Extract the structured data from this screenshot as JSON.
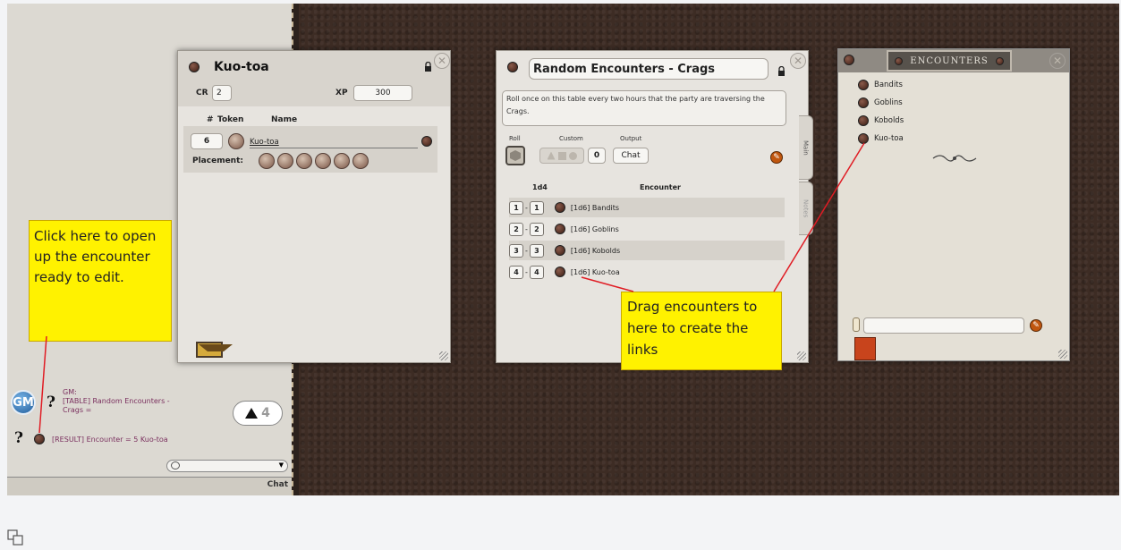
{
  "chat": {
    "gm_label": "GM",
    "line1_sender": "GM:",
    "line1_text": "[TABLE] Random Encounters -",
    "line1_text2": "Crags =",
    "line2_text": "[RESULT] Encounter = 5 Kuo-toa",
    "die_value": "4",
    "send_label": "Chat"
  },
  "npc_window": {
    "title": "Kuo-toa",
    "cr_label": "CR",
    "cr_value": "2",
    "xp_label": "XP",
    "xp_value": "300",
    "col_num": "#",
    "col_token": "Token",
    "col_name": "Name",
    "row_count": "6",
    "row_name": "Kuo-toa",
    "placement_label": "Placement:"
  },
  "table_window": {
    "title": "Random Encounters - Crags",
    "description": "Roll once on this table every two hours that the party are traversing the Crags.",
    "roll_label": "Roll",
    "custom_label": "Custom",
    "output_label": "Output",
    "custom_value": "0",
    "output_value": "Chat",
    "tab_main": "Main",
    "tab_notes": "Notes",
    "col_dice": "1d4",
    "col_encounter": "Encounter",
    "rows": [
      {
        "from": "1",
        "to": "1",
        "result": "[1d6] Bandits"
      },
      {
        "from": "2",
        "to": "2",
        "result": "[1d6] Goblins"
      },
      {
        "from": "3",
        "to": "3",
        "result": "[1d6] Kobolds"
      },
      {
        "from": "4",
        "to": "4",
        "result": "[1d6] Kuo-toa"
      }
    ]
  },
  "encounters_window": {
    "title": "ENCOUNTERS",
    "items": [
      "Bandits",
      "Goblins",
      "Kobolds",
      "Kuo-toa"
    ]
  },
  "annotations": {
    "left_note": "Click here to open up the encounter ready to edit.",
    "right_note": "Drag encounters to here to create the links"
  }
}
